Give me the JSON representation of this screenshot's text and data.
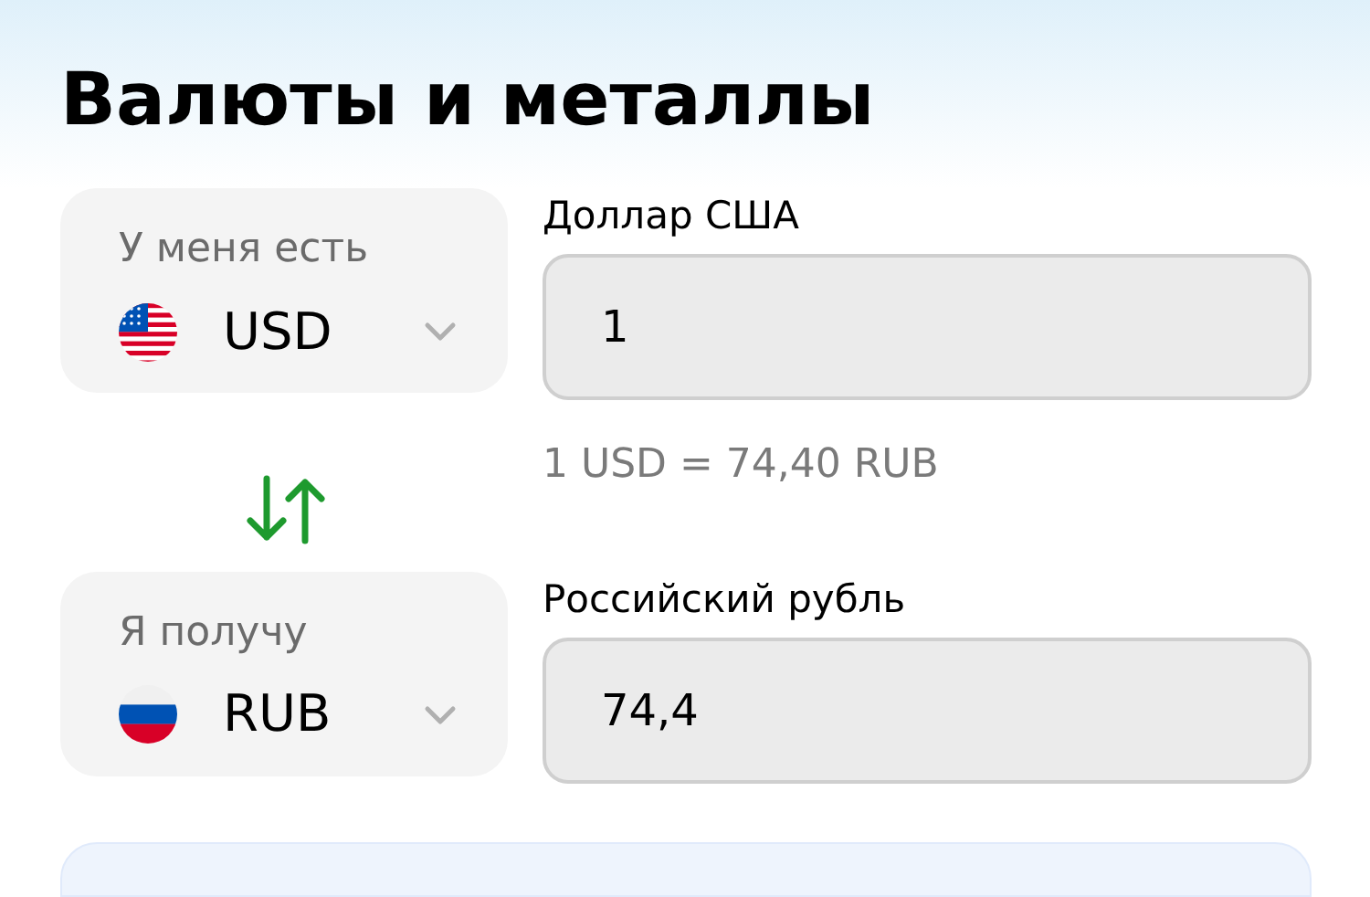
{
  "title": "Валюты и металлы",
  "converter": [
    {
      "label": "У меня есть",
      "kind": "us",
      "code": "USD",
      "currency_name": "Доллар США",
      "amount": "1",
      "rate": "1 USD = 74,40 RUB"
    },
    {
      "label": "Я получу",
      "kind": "ru",
      "code": "RUB",
      "currency_name": "Российский рубль",
      "amount": "74,4"
    }
  ]
}
